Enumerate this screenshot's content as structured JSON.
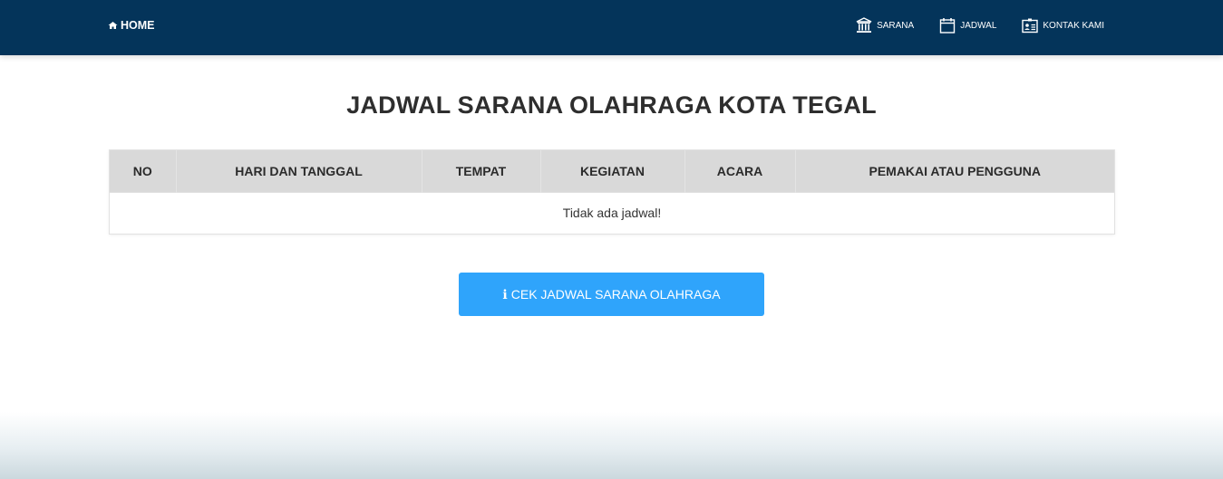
{
  "colors": {
    "navbar": "#04345a",
    "button": "#2fa4fb",
    "table_header": "#d9d9d9"
  },
  "nav": {
    "home": {
      "label": "HOME",
      "icon": "home-icon"
    },
    "items": [
      {
        "label": "SARANA",
        "icon": "institution-icon"
      },
      {
        "label": "JADWAL",
        "icon": "calendar-icon"
      },
      {
        "label": "KONTAK KAMI",
        "icon": "contact-card-icon"
      }
    ]
  },
  "page": {
    "title": "JADWAL SARANA OLAHRAGA KOTA TEGAL"
  },
  "table": {
    "columns": [
      "NO",
      "HARI DAN TANGGAL",
      "TEMPAT",
      "KEGIATAN",
      "ACARA",
      "PEMAKAI ATAU PENGGUNA"
    ],
    "empty_message": "Tidak ada jadwal!"
  },
  "button": {
    "label": "CEK JADWAL SARANA OLAHRAGA",
    "icon": "info-icon"
  }
}
